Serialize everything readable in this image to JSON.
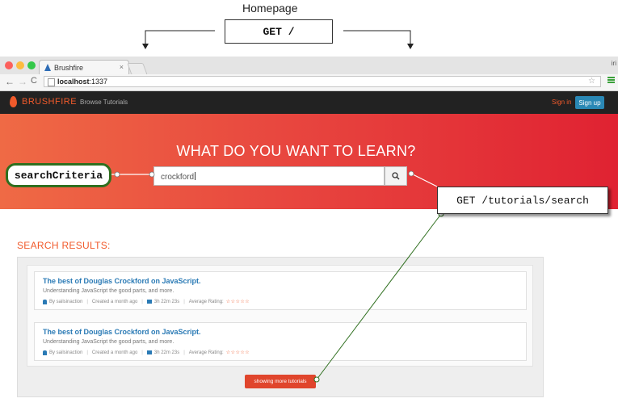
{
  "annotations": {
    "homepage_title": "Homepage",
    "get_root": "GET /",
    "search_criteria": "searchCriteria",
    "get_search": "GET /tutorials/search"
  },
  "browser": {
    "tab_title": "Brushfire",
    "tab_close": "×",
    "profile_text": "iri",
    "url_host": "localhost",
    "url_port": ":1337"
  },
  "nav": {
    "brand": "BRUSHFIRE",
    "browse": "Browse Tutorials",
    "sign_in": "Sign in",
    "sign_up": "Sign up"
  },
  "hero": {
    "heading": "WHAT DO YOU WANT TO LEARN?",
    "search_value": "crockford"
  },
  "results": {
    "title": "SEARCH RESULTS:",
    "items": [
      {
        "title": "The best of Douglas Crockford on JavaScript.",
        "description": "Understanding JavaScript the good parts, and more.",
        "author": "By sailsinaction",
        "created": "Created a month ago",
        "duration": "3h 22m 23s",
        "rating_label": "Average Rating:",
        "stars": "☆☆☆☆☆"
      },
      {
        "title": "The best of Douglas Crockford on JavaScript.",
        "description": "Understanding JavaScript the good parts, and more.",
        "author": "By sailsinaction",
        "created": "Created a month ago",
        "duration": "3h 22m 23s",
        "rating_label": "Average Rating:",
        "stars": "☆☆☆☆☆"
      }
    ],
    "more_button": "showing more tutorials"
  },
  "colors": {
    "brand_orange": "#f15a2b",
    "link_blue": "#2a7ab5",
    "annotation_green": "#2f6f1f"
  }
}
